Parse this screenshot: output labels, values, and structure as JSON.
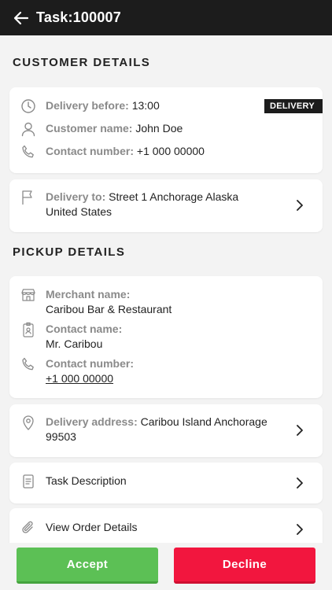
{
  "header": {
    "title": "Task:100007"
  },
  "customer": {
    "section_title": "CUSTOMER DETAILS",
    "badge": "DELIVERY",
    "delivery_before_label": "Delivery before:",
    "delivery_before_value": "13:00",
    "customer_name_label": "Customer name:",
    "customer_name_value": "John Doe",
    "contact_label": "Contact number:",
    "contact_value": "+1 000 00000",
    "delivery_to_label": "Delivery to:",
    "delivery_to_line1": "Street 1 Anchorage Alaska",
    "delivery_to_line2": "United States"
  },
  "pickup": {
    "section_title": "PICKUP DETAILS",
    "merchant_label": "Merchant name:",
    "merchant_value": "Caribou Bar & Restaurant",
    "contact_name_label": "Contact name:",
    "contact_name_value": "Mr. Caribou",
    "contact_number_label": "Contact number:",
    "contact_number_value": "+1 000 00000",
    "delivery_address_label": "Delivery address:",
    "delivery_address_line1": "Caribou Island Anchorage",
    "delivery_address_line2": "99503"
  },
  "links": {
    "task_description": "Task Description",
    "view_order_details": "View Order Details"
  },
  "actions": {
    "accept": "Accept",
    "decline": "Decline"
  },
  "colors": {
    "header_bg": "#1c1c1c",
    "accept": "#5cc055",
    "decline": "#f2163e",
    "label_gray": "#8a8a8a"
  }
}
